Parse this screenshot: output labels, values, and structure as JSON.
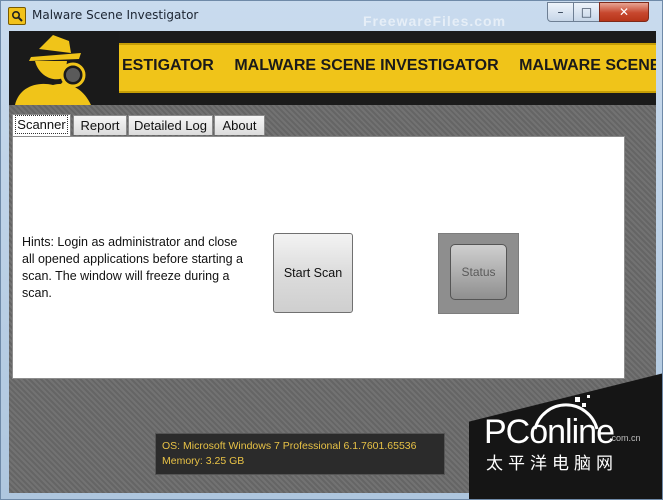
{
  "window": {
    "title": "Malware Scene Investigator",
    "watermark": "FreewareFiles.com",
    "minimize_glyph": "–",
    "maximize_glyph": "□",
    "close_glyph": "✕"
  },
  "banner": {
    "repeat_text": [
      "ESTIGATOR",
      "MALWARE SCENE INVESTIGATOR",
      "MALWARE SCENE INV"
    ],
    "accent_color": "#f0c419"
  },
  "tabs": [
    {
      "label": "Scanner",
      "active": true
    },
    {
      "label": "Report",
      "active": false
    },
    {
      "label": "Detailed Log",
      "active": false
    },
    {
      "label": "About",
      "active": false
    }
  ],
  "scanner": {
    "hints": "Hints: Login as administrator and close all opened applications before starting a scan. The window will freeze during a scan.",
    "start_scan_label": "Start Scan",
    "status_label": "Status"
  },
  "sysinfo": {
    "os": "OS: Microsoft Windows 7 Professional  6.1.7601.65536",
    "memory": "Memory: 3.25 GB"
  },
  "overlay_logo": {
    "brand": "PConline",
    "domain": ".com.cn",
    "chinese": "太平洋电脑网"
  }
}
